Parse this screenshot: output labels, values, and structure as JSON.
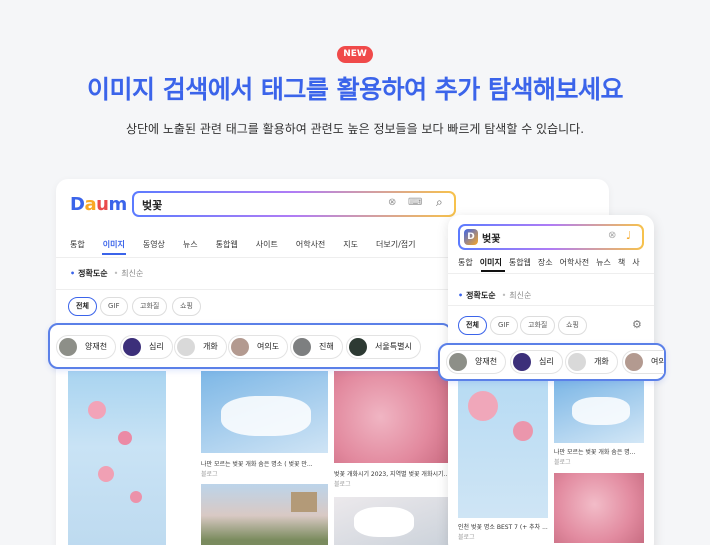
{
  "badge": "NEW",
  "headline": "이미지 검색에서 태그를 활용하여 추가 탐색해보세요",
  "subline": "상단에 노출된 관련 태그를 활용하여 관련도 높은 정보들을 보다 빠르게 탐색할 수 있습니다.",
  "colors": {
    "accent": "#3b64ea",
    "badge": "#f04a4a"
  },
  "desktop": {
    "logo": [
      "D",
      "a",
      "u",
      "m"
    ],
    "query": "벚꽃",
    "tabs": [
      "통합",
      "이미지",
      "동영상",
      "뉴스",
      "통합웹",
      "사이트",
      "어학사전",
      "지도",
      "더보기/접기"
    ],
    "active_tab": "이미지",
    "sort": {
      "active": "정확도순",
      "other": "최신순"
    },
    "filters": [
      "전체",
      "GIF",
      "고화질",
      "쇼핑"
    ],
    "tags": [
      "양재천",
      "심리",
      "개화",
      "여의도",
      "진해",
      "서울특별시"
    ],
    "results": [
      {
        "caption": "나만 모르는 벚꽃 개화 숨은 명소 ( 벚꽃 만...",
        "source": "블로그"
      },
      {
        "caption": "벚꽃 개화시기 2023, 지역별 벚꽃 개화시기...",
        "source": "블로그"
      }
    ]
  },
  "mobile": {
    "logo": "D",
    "query": "벚꽃",
    "tabs": [
      "통합",
      "이미지",
      "통합웹",
      "장소",
      "어학사전",
      "뉴스",
      "책",
      "사"
    ],
    "active_tab": "이미지",
    "sort": {
      "active": "정확도순",
      "other": "최신순"
    },
    "filters": [
      "전체",
      "GIF",
      "고화질",
      "쇼핑"
    ],
    "tags": [
      "양재천",
      "심리",
      "개화",
      "여의"
    ],
    "results": [
      {
        "caption": "나만 모르는 벚꽃 개화 숨은 명...",
        "source": "블로그"
      },
      {
        "caption": "인천 벚꽃 명소 BEST 7 (+ 추차 ...",
        "source": "블로그"
      }
    ]
  }
}
